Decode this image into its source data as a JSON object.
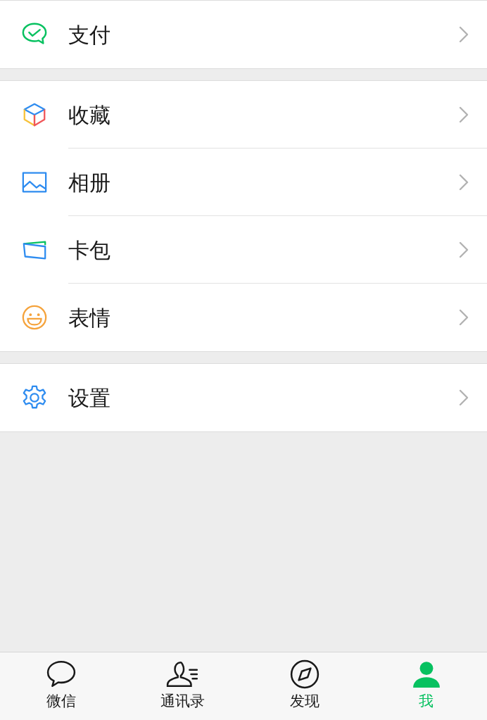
{
  "sections": [
    {
      "items": [
        {
          "label": "支付"
        }
      ]
    },
    {
      "items": [
        {
          "label": "收藏"
        },
        {
          "label": "相册"
        },
        {
          "label": "卡包"
        },
        {
          "label": "表情"
        }
      ]
    },
    {
      "items": [
        {
          "label": "设置"
        }
      ]
    }
  ],
  "tab_bar": [
    {
      "label": "微信",
      "selected": false
    },
    {
      "label": "通讯录",
      "selected": false
    },
    {
      "label": "发现",
      "selected": false
    },
    {
      "label": "我",
      "selected": true
    }
  ]
}
